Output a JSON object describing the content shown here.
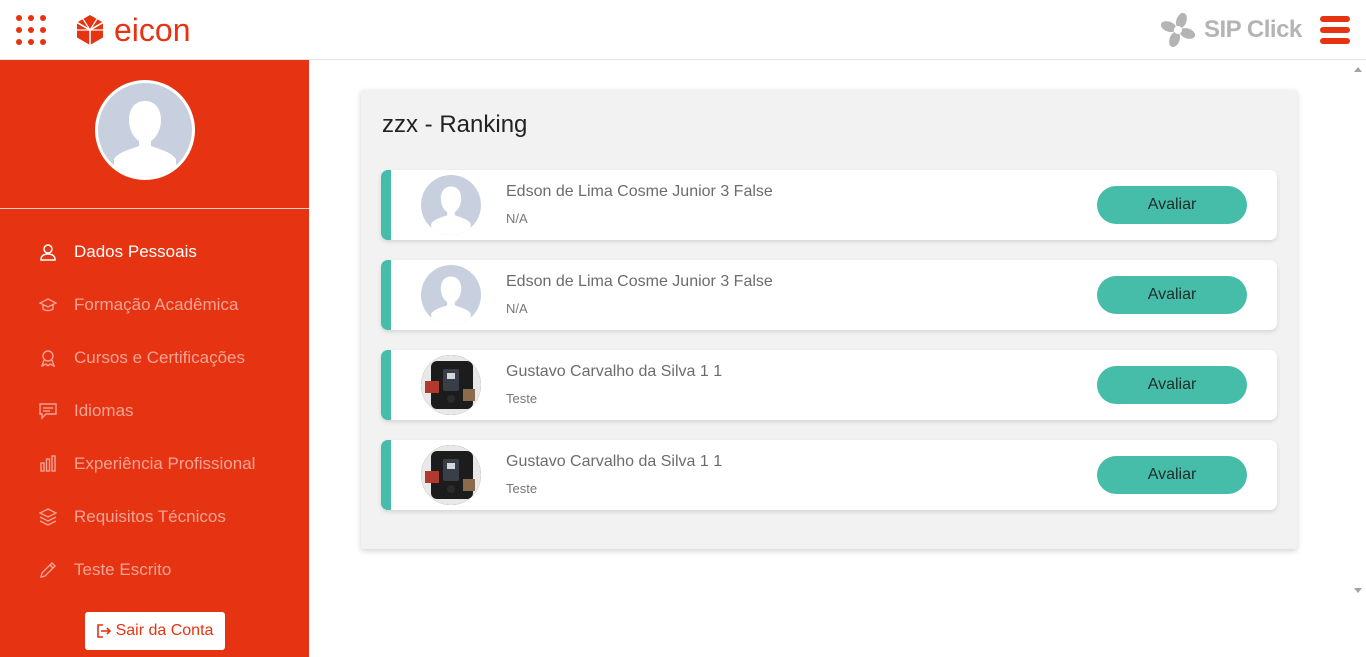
{
  "header": {
    "logo_text": "eicon",
    "brand_right": "SIP Click",
    "icons": [
      "apps-grid-icon",
      "eicon-logo-icon",
      "sipclick-logo-icon",
      "hamburger-menu-icon"
    ]
  },
  "sidebar": {
    "items": [
      {
        "label": "Dados Pessoais",
        "icon": "user-icon",
        "active": true
      },
      {
        "label": "Formação Acadêmica",
        "icon": "graduation-cap-icon",
        "active": false
      },
      {
        "label": "Cursos e Certificações",
        "icon": "award-icon",
        "active": false
      },
      {
        "label": "Idiomas",
        "icon": "chat-icon",
        "active": false
      },
      {
        "label": "Experiência Profissional",
        "icon": "bar-chart-icon",
        "active": false
      },
      {
        "label": "Requisitos Técnicos",
        "icon": "layers-icon",
        "active": false
      },
      {
        "label": "Teste Escrito",
        "icon": "pencil-icon",
        "active": false
      }
    ],
    "logout_label": "Sair da Conta"
  },
  "main": {
    "title": "zzx - Ranking",
    "rows": [
      {
        "name": "Edson de Lima Cosme Junior 3 False",
        "subtitle": "N/A",
        "button": "Avaliar",
        "photo": "default-avatar"
      },
      {
        "name": "Edson de Lima Cosme Junior 3 False",
        "subtitle": "N/A",
        "button": "Avaliar",
        "photo": "default-avatar"
      },
      {
        "name": "Gustavo Carvalho da Silva 1 1",
        "subtitle": "Teste",
        "button": "Avaliar",
        "photo": "device-photo"
      },
      {
        "name": "Gustavo Carvalho da Silva 1 1",
        "subtitle": "Teste",
        "button": "Avaliar",
        "photo": "device-photo"
      }
    ]
  },
  "colors": {
    "brand": "#e63312",
    "accent": "#45bda9",
    "card_bg": "#f2f2f2"
  }
}
